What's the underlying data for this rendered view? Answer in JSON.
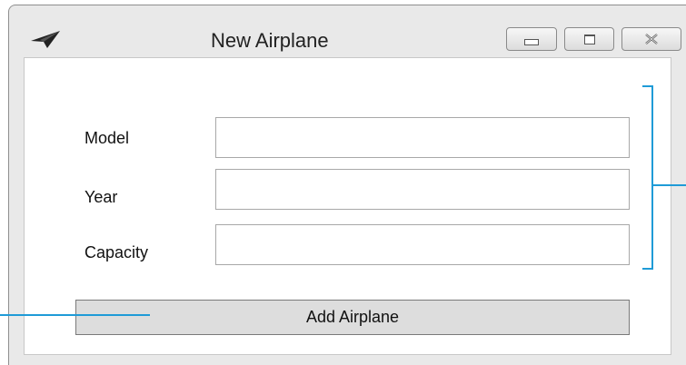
{
  "window": {
    "title": "New Airplane",
    "icon": "paper-plane-icon",
    "controls": {
      "minimize": "minimize-icon",
      "maximize": "maximize-icon",
      "close": "close-icon"
    }
  },
  "form": {
    "fields": [
      {
        "label": "Model",
        "value": ""
      },
      {
        "label": "Year",
        "value": ""
      },
      {
        "label": "Capacity",
        "value": ""
      }
    ],
    "submit_label": "Add Airplane"
  },
  "colors": {
    "callout_line": "#1f9bd7",
    "window_frame": "#e9e9e9",
    "button_face": "#dddddd"
  }
}
